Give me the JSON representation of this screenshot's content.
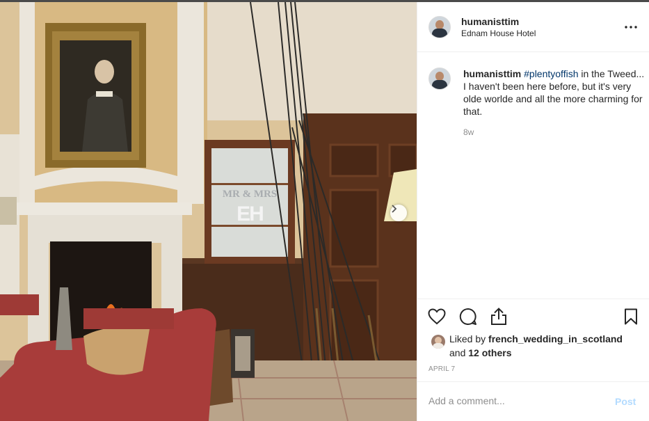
{
  "post": {
    "username": "humanisttim",
    "location": "Ednam House Hotel",
    "caption": {
      "username": "humanisttim",
      "hashtag": "#plentyoffish",
      "text": " in the Tweed... I haven't been here before, but it's very olde worlde and all the more charming for that."
    },
    "time_ago": "8w",
    "photo_sign_line1": "MR & MRS",
    "photo_sign_line2": "EH"
  },
  "likes": {
    "prefix": "Liked by ",
    "first_user": "french_wedding_in_scotland",
    "and": "and ",
    "others": "12 others"
  },
  "date": "APRIL 7",
  "comment": {
    "placeholder": "Add a comment...",
    "post_label": "Post"
  },
  "icons": {
    "more": "more-options-icon",
    "like": "heart-icon",
    "comment": "comment-icon",
    "share": "share-icon",
    "save": "bookmark-icon",
    "next": "chevron-right-icon"
  },
  "colors": {
    "hashtag": "#003569",
    "secondary_text": "#8e8e8e",
    "post_button_disabled": "#b3dbff",
    "divider": "#efefef"
  }
}
